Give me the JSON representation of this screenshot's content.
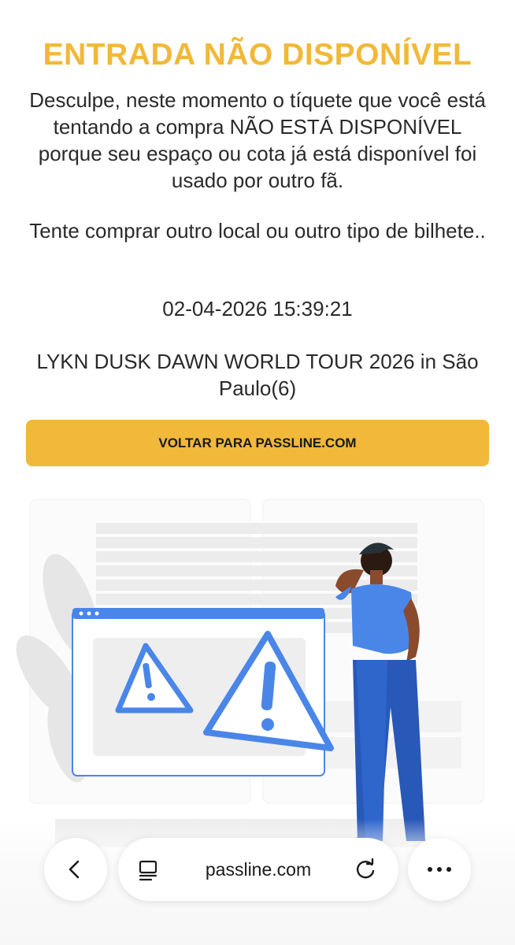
{
  "page": {
    "title": "ENTRADA NÃO DISPONÍVEL",
    "message": "Desculpe, neste momento o tíquete que você está tentando a compra NÃO ESTÁ DISPONÍVEL porque seu espaço ou cota já está disponível foi usado por outro fã.",
    "suggestion": "Tente comprar outro local ou outro tipo de bilhete..",
    "timestamp": "02-04-2026 15:39:21",
    "event": "LYKN DUSK DAWN WORLD TOUR 2026 in São Paulo(6)",
    "cta_label": "VOLTAR PARA PASSLINE.COM"
  },
  "illustration": {
    "icon": "warning-illustration",
    "accent_color": "#4A86E8"
  },
  "browser": {
    "url": "passline.com",
    "back_icon": "chevron-left-icon",
    "reader_icon": "reader-mode-icon",
    "reload_icon": "reload-icon",
    "more_icon": "more-icon"
  },
  "colors": {
    "brand": "#F2B83A",
    "text": "#2a2a2a"
  }
}
